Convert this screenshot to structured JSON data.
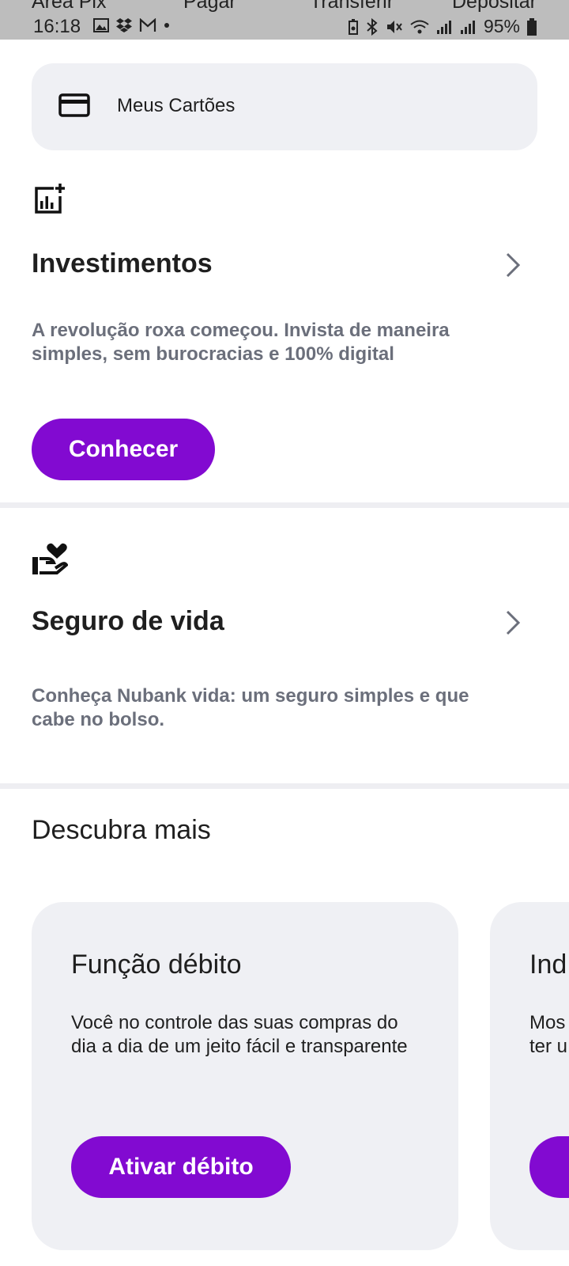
{
  "status_bar": {
    "shortcuts": [
      "Área Pix",
      "Pagar",
      "Transferir",
      "Depositar"
    ],
    "time": "16:18",
    "battery": "95%"
  },
  "cards": {
    "label": "Meus Cartões"
  },
  "investments": {
    "title": "Investimentos",
    "description": "A revolução roxa começou. Invista de maneira simples, sem burocracias e 100% digital",
    "button": "Conhecer"
  },
  "life_insurance": {
    "title": "Seguro de vida",
    "description": "Conheça Nubank vida: um seguro simples e que cabe no bolso."
  },
  "discover": {
    "title": "Descubra mais",
    "cards": [
      {
        "title": "Função débito",
        "description": "Você no controle das suas compras do dia a dia de um jeito fácil e transparente",
        "button": "Ativar débito"
      },
      {
        "title": "Ind",
        "description": "Mos ter u",
        "button": ""
      }
    ]
  },
  "colors": {
    "accent": "#820ad1",
    "card_bg": "#eff0f4",
    "muted_text": "#6b6f7b"
  }
}
